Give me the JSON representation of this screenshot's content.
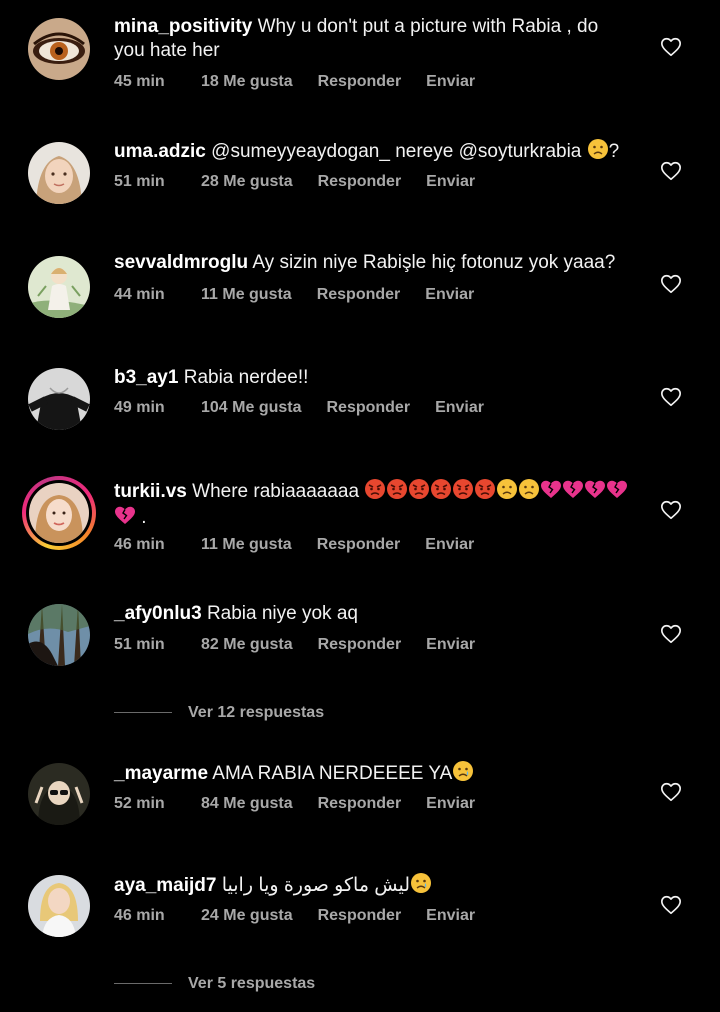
{
  "comments": [
    {
      "username": "mina_positivity",
      "text": "Why u don't put a picture with Rabia , do you hate her",
      "time": "45 min",
      "likes": "18 Me gusta",
      "reply": "Responder",
      "send": "Enviar",
      "avatar": "eye-avatar"
    },
    {
      "username": "uma.adzic",
      "text": "@sumeyyeaydogan_ nereye @soyturkrabia",
      "text_end": "?",
      "time": "51 min",
      "likes": "28 Me gusta",
      "reply": "Responder",
      "send": "Enviar",
      "avatar": "woman-avatar"
    },
    {
      "username": "sevvaldmroglu",
      "text": "Ay sizin niye Rabişle hiç fotonuz yok yaaa?",
      "time": "44 min",
      "likes": "11 Me gusta",
      "reply": "Responder",
      "send": "Enviar",
      "avatar": "illustration-avatar"
    },
    {
      "username": "b3_ay1",
      "text": "Rabia nerdee!!",
      "time": "49 min",
      "likes": "104 Me gusta",
      "reply": "Responder",
      "send": "Enviar",
      "avatar": "dress-avatar"
    },
    {
      "username": "turkii.vs",
      "text": "Where rabiaaaaaaa",
      "text_end": ".",
      "time": "46 min",
      "likes": "11 Me gusta",
      "reply": "Responder",
      "send": "Enviar",
      "avatar": "selfie-avatar"
    },
    {
      "username": "_afy0nlu3",
      "text": "Rabia niye yok aq",
      "time": "51 min",
      "likes": "82 Me gusta",
      "reply": "Responder",
      "send": "Enviar",
      "avatar": "forest-avatar"
    },
    {
      "username": "_mayarme",
      "text": "AMA RABIA NERDEEEE YA",
      "time": "52 min",
      "likes": "84 Me gusta",
      "reply": "Responder",
      "send": "Enviar",
      "avatar": "cartoon-avatar"
    },
    {
      "username": "aya_maijd7",
      "text": "ليش ماكو صورة ويا رابيا",
      "time": "46 min",
      "likes": "24 Me gusta",
      "reply": "Responder",
      "send": "Enviar",
      "avatar": "blonde-avatar"
    }
  ],
  "view_replies": [
    {
      "label": "Ver 12 respuestas"
    },
    {
      "label": "Ver 5 respuestas"
    }
  ],
  "icons": {
    "like": "heart-outline-icon",
    "sad": "sad-face-emoji",
    "angry": "angry-face-emoji",
    "frown": "frowning-face-emoji",
    "broken_heart": "broken-heart-emoji",
    "crying": "crying-face-emoji"
  },
  "colors": {
    "background": "#000000",
    "text": "#f2f2f2",
    "secondary": "#a8a8a8",
    "story_ring": "#ee2a7b"
  }
}
